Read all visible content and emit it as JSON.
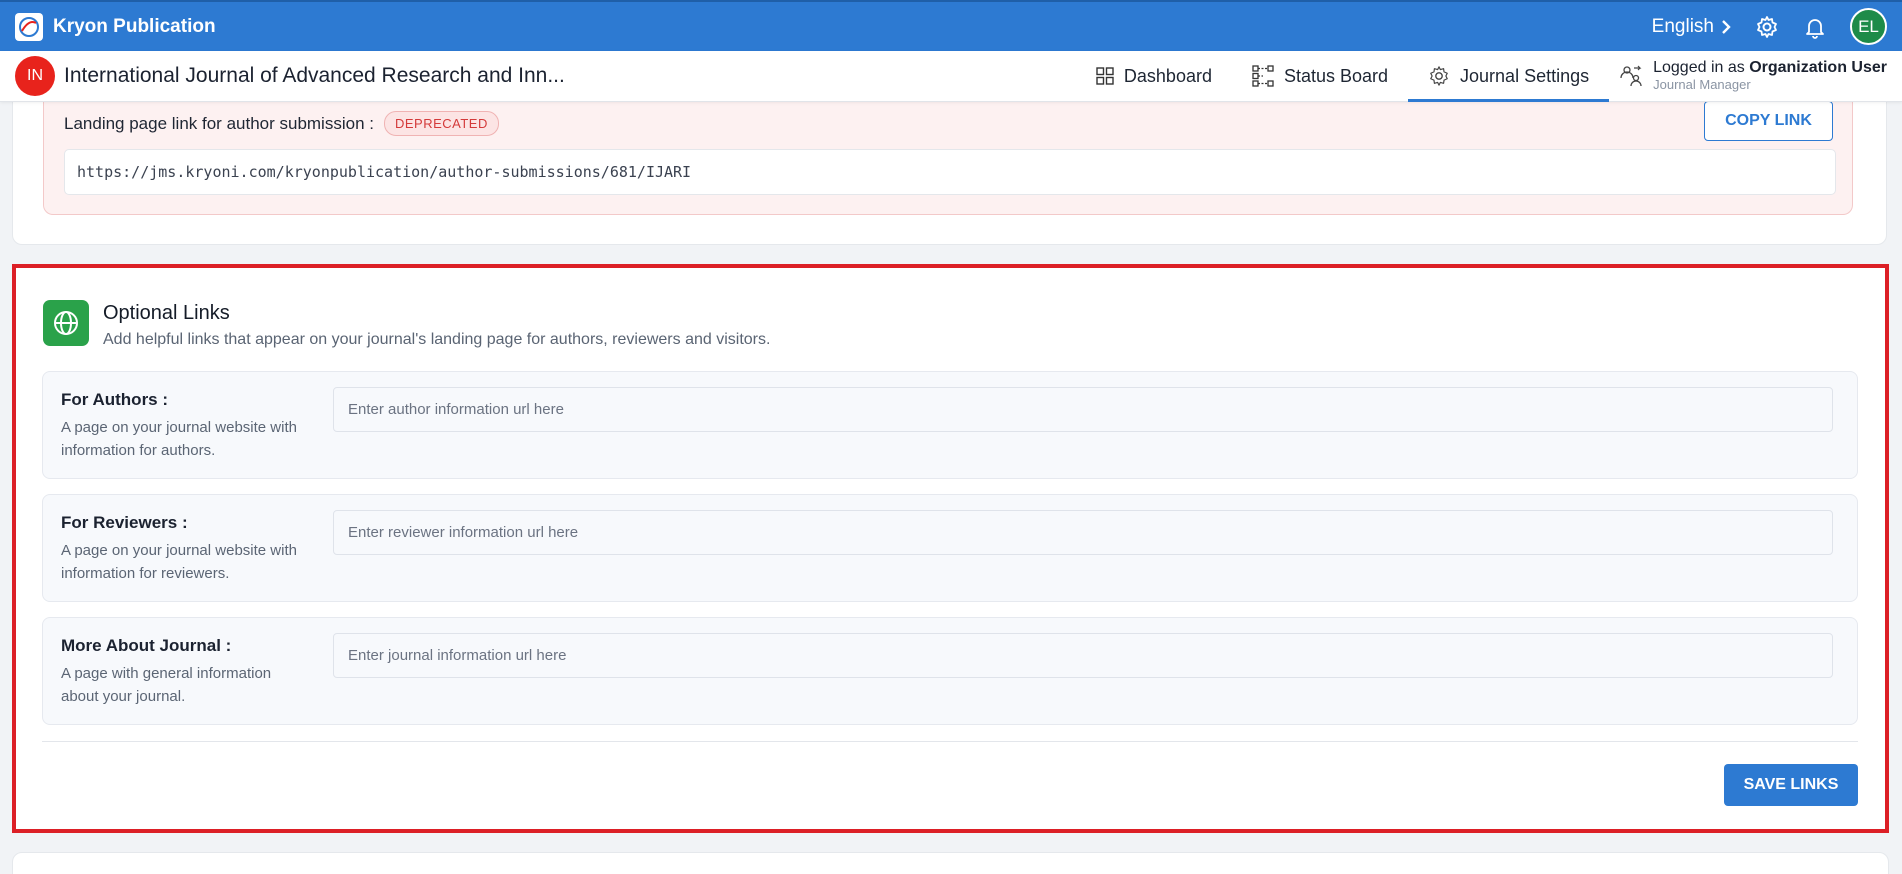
{
  "app": {
    "title": "Kryon Publication"
  },
  "topbar": {
    "language": "English",
    "avatar_initials": "EL"
  },
  "journal": {
    "badge": "IN",
    "title": "International Journal of Advanced Research and Inn..."
  },
  "nav": [
    {
      "label": "Dashboard",
      "icon": "dashboard-grid-icon"
    },
    {
      "label": "Status Board",
      "icon": "status-board-icon"
    },
    {
      "label": "Journal Settings",
      "icon": "gear-icon",
      "active": true
    }
  ],
  "user": {
    "logged_prefix": "Logged in as ",
    "name": "Organization User",
    "role": "Journal Manager"
  },
  "landing": {
    "label": "Landing page link for author submission :",
    "badge": "DEPRECATED",
    "copy_label": "COPY LINK",
    "url": "https://jms.kryoni.com/kryonpublication/author-submissions/681/IJARI"
  },
  "optional_links": {
    "title": "Optional Links",
    "subtitle": "Add helpful links that appear on your journal's landing page for authors, reviewers and visitors.",
    "rows": [
      {
        "label": "For Authors :",
        "desc": "A page on your journal website with information for authors.",
        "placeholder": "Enter author information url here",
        "value": ""
      },
      {
        "label": "For Reviewers :",
        "desc": "A page on your journal website with information for reviewers.",
        "placeholder": "Enter reviewer information url here",
        "value": ""
      },
      {
        "label": "More About Journal :",
        "desc": "A page with general information about your journal.",
        "placeholder": "Enter journal information url here",
        "value": ""
      }
    ],
    "save_label": "SAVE LINKS"
  },
  "colors": {
    "primary": "#2d7ad2",
    "danger": "#dc1f26",
    "success": "#2aa24a",
    "journal_badge": "#e8231c"
  }
}
